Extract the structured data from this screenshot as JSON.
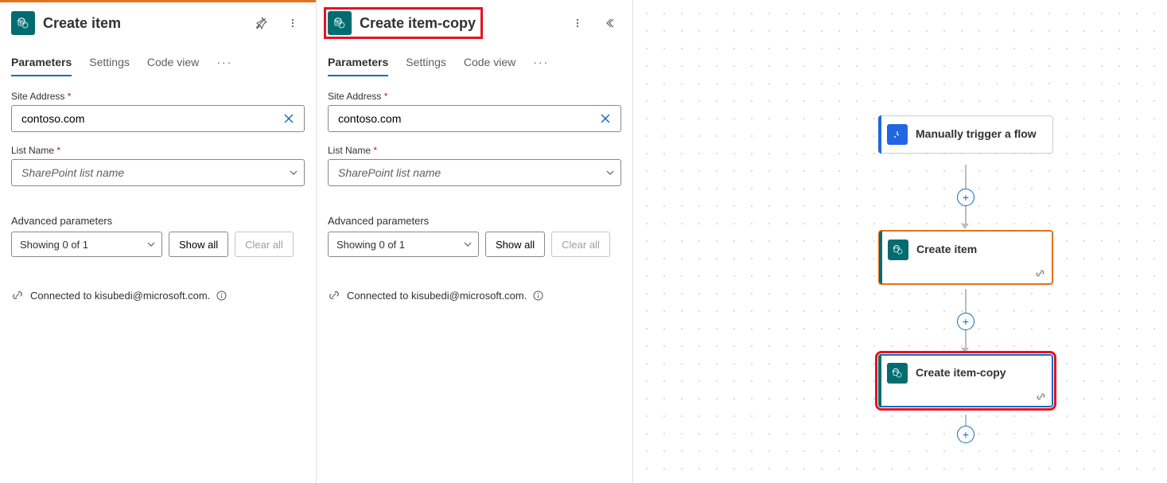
{
  "panel1": {
    "title": "Create item",
    "tabs": [
      "Parameters",
      "Settings",
      "Code view"
    ],
    "siteLabel": "Site Address",
    "siteValue": "contoso.com",
    "listLabel": "List Name",
    "listPlaceholder": "SharePoint list name",
    "advLabel": "Advanced parameters",
    "advDropdown": "Showing 0 of 1",
    "showAll": "Show all",
    "clearAll": "Clear all",
    "connected": "Connected to kisubedi@microsoft.com."
  },
  "panel2": {
    "title": "Create item-copy",
    "tabs": [
      "Parameters",
      "Settings",
      "Code view"
    ],
    "siteLabel": "Site Address",
    "siteValue": "contoso.com",
    "listLabel": "List Name",
    "listPlaceholder": "SharePoint list name",
    "advLabel": "Advanced parameters",
    "advDropdown": "Showing 0 of 1",
    "showAll": "Show all",
    "clearAll": "Clear all",
    "connected": "Connected to kisubedi@microsoft.com."
  },
  "canvas": {
    "trigger": {
      "title": "Manually trigger a flow"
    },
    "action1": {
      "title": "Create item"
    },
    "action2": {
      "title": "Create item-copy"
    }
  }
}
